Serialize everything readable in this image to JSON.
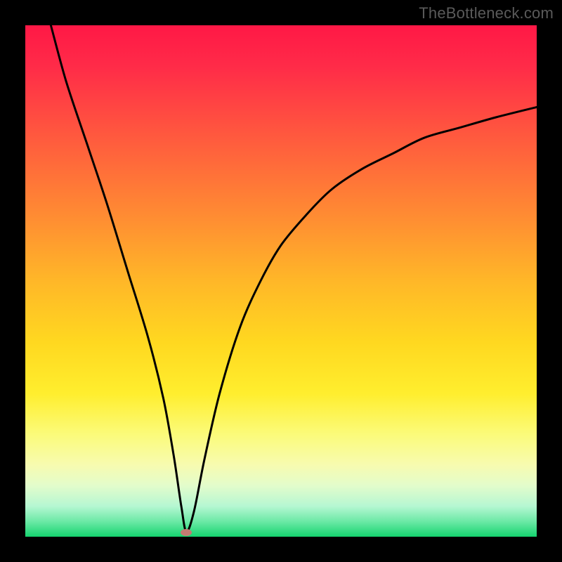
{
  "watermark": "TheBottleneck.com",
  "chart_data": {
    "type": "line",
    "title": "",
    "xlabel": "",
    "ylabel": "",
    "xlim": [
      0,
      100
    ],
    "ylim": [
      0,
      100
    ],
    "grid": false,
    "series": [
      {
        "name": "curve",
        "x": [
          5,
          8,
          12,
          16,
          20,
          24,
          27,
          29,
          30.5,
          31.5,
          33,
          35,
          38,
          42,
          46,
          50,
          55,
          60,
          66,
          72,
          78,
          85,
          92,
          100
        ],
        "values": [
          100,
          89,
          77,
          65,
          52,
          39,
          27,
          16,
          6,
          1,
          5,
          15,
          28,
          41,
          50,
          57,
          63,
          68,
          72,
          75,
          78,
          80,
          82,
          84
        ]
      }
    ],
    "annotations": [
      {
        "name": "minimum-marker",
        "x": 31.5,
        "y": 0.8
      }
    ],
    "background_gradient": {
      "direction": "vertical",
      "stops": [
        {
          "pos": 0.0,
          "color": "#ff1846"
        },
        {
          "pos": 0.4,
          "color": "#ff8e32"
        },
        {
          "pos": 0.7,
          "color": "#ffee2e"
        },
        {
          "pos": 0.9,
          "color": "#e3fccb"
        },
        {
          "pos": 1.0,
          "color": "#15d46f"
        }
      ]
    }
  }
}
